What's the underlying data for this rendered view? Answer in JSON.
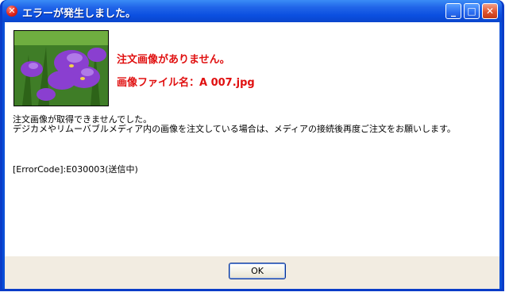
{
  "window": {
    "title": "エラーが発生しました。",
    "title_icon": "error-x-icon",
    "controls": {
      "minimize": "minimize-icon",
      "maximize": "maximize-icon",
      "close": "close-icon"
    }
  },
  "content": {
    "image": "purple-iris-flowers-photo",
    "headline": "注文画像がありません。",
    "filename_line": "画像ファイル名：A 007.jpg",
    "message_line1": "注文画像が取得できませんでした。",
    "message_line2": "デジカメやリムーバブルメディア内の画像を注文している場合は、メディアの接続後再度ご注文をお願いします。",
    "error_code": "[ErrorCode]:E030003(送信中)"
  },
  "footer": {
    "ok_label": "OK"
  },
  "colors": {
    "titlebar": "#0a4fd8",
    "headline": "#e01010",
    "footer_bg": "#f2ece1"
  }
}
